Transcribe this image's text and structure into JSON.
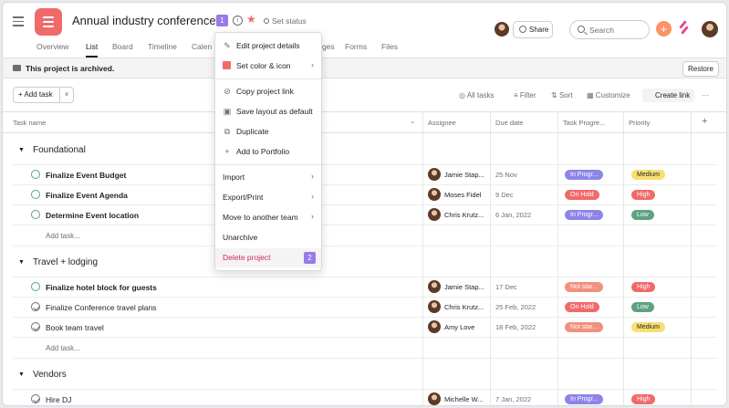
{
  "header": {
    "project_title": "Annual industry conference",
    "badge_1": "1",
    "info_icon": "info-icon",
    "set_status": "Set status",
    "share": "Share",
    "search_placeholder": "Search",
    "plus": "+"
  },
  "tabs": [
    "Overview",
    "List",
    "Board",
    "Timeline",
    "Calen",
    "ges",
    "Forms",
    "Files"
  ],
  "archived": {
    "message": "This project is archived.",
    "restore": "Restore"
  },
  "toolbar": {
    "add_task": "+ Add task",
    "caret": "∨",
    "all_tasks": "All tasks",
    "filter": "Filter",
    "sort": "Sort",
    "customize": "Customize",
    "create_link": "Create link",
    "more": "···"
  },
  "columns": {
    "task_name": "Task name",
    "assignee": "Assignee",
    "due_date": "Due date",
    "task_progress": "Task Progre...",
    "priority": "Priority",
    "add_col": "+"
  },
  "sections": [
    {
      "name": "Foundational",
      "add_task": "Add task...",
      "tasks": [
        {
          "name": "Finalize Event Budget",
          "bold": true,
          "done": false,
          "assignee": "Jamie Stap...",
          "due": "25 Nov",
          "progress": "In Progr...",
          "priority": "Medium"
        },
        {
          "name": "Finalize Event Agenda",
          "bold": true,
          "done": false,
          "assignee": "Moses Fidel",
          "due": "9 Dec",
          "progress": "On Hold",
          "priority": "High"
        },
        {
          "name": "Determine Event location",
          "bold": true,
          "done": false,
          "assignee": "Chris Krutz...",
          "due": "6 Jan, 2022",
          "progress": "In Progr...",
          "priority": "Low"
        }
      ]
    },
    {
      "name": "Travel + lodging",
      "add_task": "Add task...",
      "tasks": [
        {
          "name": "Finalize hotel block for guests",
          "bold": true,
          "done": false,
          "assignee": "Jamie Stap...",
          "due": "17 Dec",
          "progress": "Not star...",
          "priority": "High"
        },
        {
          "name": "Finalize Conference travel plans",
          "bold": false,
          "done": true,
          "assignee": "Chris Krutz...",
          "due": "25 Feb, 2022",
          "progress": "On Hold",
          "priority": "Low"
        },
        {
          "name": "Book team travel",
          "bold": false,
          "done": true,
          "assignee": "Amy Love",
          "due": "18 Feb, 2022",
          "progress": "Not star...",
          "priority": "Medium"
        }
      ]
    },
    {
      "name": "Vendors",
      "tasks": [
        {
          "name": "Hire DJ",
          "bold": false,
          "done": true,
          "assignee": "Michelle W...",
          "due": "7 Jan, 2022",
          "progress": "In Progr...",
          "priority": "High"
        }
      ]
    }
  ],
  "menu": {
    "items": [
      {
        "label": "Edit project details",
        "icon": "pencil-icon"
      },
      {
        "label": "Set color & icon",
        "icon": "color-swatch-icon"
      },
      {
        "label": "Copy project link",
        "icon": "link-icon"
      },
      {
        "label": "Save layout as default",
        "icon": "save-icon"
      },
      {
        "label": "Duplicate",
        "icon": "duplicate-icon"
      },
      {
        "label": "Add to Portfolio",
        "icon": "plus-icon"
      },
      {
        "label": "Import"
      },
      {
        "label": "Export/Print"
      },
      {
        "label": "Move to another team"
      },
      {
        "label": "Unarchive"
      },
      {
        "label": "Delete project"
      }
    ],
    "badge_2": "2"
  },
  "colors": {
    "accent": "#f06a6a",
    "in_progress": "#8d84e8",
    "on_hold": "#f06a6a",
    "not_started": "#f1907c",
    "high": "#f06a6a",
    "medium": "#f8df72",
    "low": "#5da283",
    "badge": "#9a7ae8",
    "danger_text": "#c92f54"
  }
}
